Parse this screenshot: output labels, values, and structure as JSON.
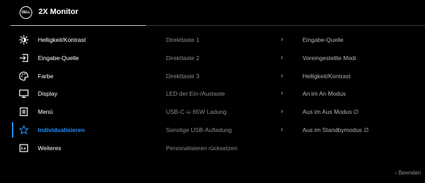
{
  "header": {
    "logo_text": "DELL",
    "title": "2X Monitor"
  },
  "menu": [
    {
      "label": "Helligkeit/Kontrast",
      "icon": "brightness-icon"
    },
    {
      "label": "Eingabe-Quelle",
      "icon": "input-source-icon"
    },
    {
      "label": "Farbe",
      "icon": "color-icon"
    },
    {
      "label": "Display",
      "icon": "display-icon"
    },
    {
      "label": "Menü",
      "icon": "menu-icon"
    },
    {
      "label": "Individualisieren",
      "icon": "star-icon",
      "active": true
    },
    {
      "label": "Weiteres",
      "icon": "others-icon"
    }
  ],
  "settings": [
    "Direkttaste 1",
    "Direkttaste 2",
    "Direkttaste 3",
    "LED der Ein-/Austaste",
    "USB-C ➯ 65W Ladung",
    "Sonstige USB-Aufladung",
    "Personalisieren rücksetzen"
  ],
  "values": [
    "Eingabe-Quelle",
    "Voreingestellte Modi",
    "Helligkeit/Kontrast",
    "An im An Modus",
    "Aus im Aus Modus ∅",
    "Aus im Standbymodus ∅"
  ],
  "arrow": "›",
  "footer": {
    "exit_label": "‹ Beenden"
  },
  "colors": {
    "accent": "#1e90ff",
    "background": "#000000"
  }
}
